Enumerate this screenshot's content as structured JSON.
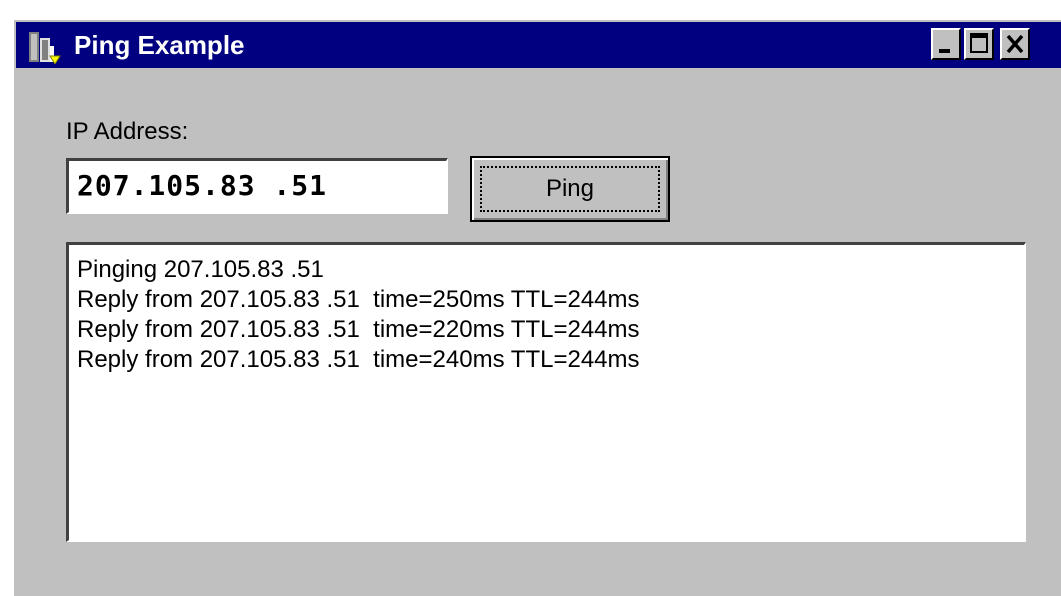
{
  "window": {
    "title": "Ping Example"
  },
  "form": {
    "ip_label": "IP Address:",
    "ip_value": "207.105.83 .51",
    "ping_button": "Ping"
  },
  "output": {
    "lines": [
      "Pinging 207.105.83 .51",
      "Reply from 207.105.83 .51  time=250ms TTL=244ms",
      "Reply from 207.105.83 .51  time=220ms TTL=244ms",
      "Reply from 207.105.83 .51  time=240ms TTL=244ms"
    ]
  },
  "icons": {
    "app": "app-icon",
    "minimize": "minimize-icon",
    "maximize": "maximize-icon",
    "close": "close-icon"
  },
  "colors": {
    "titlebar": "#000080",
    "face": "#c0c0c0"
  }
}
